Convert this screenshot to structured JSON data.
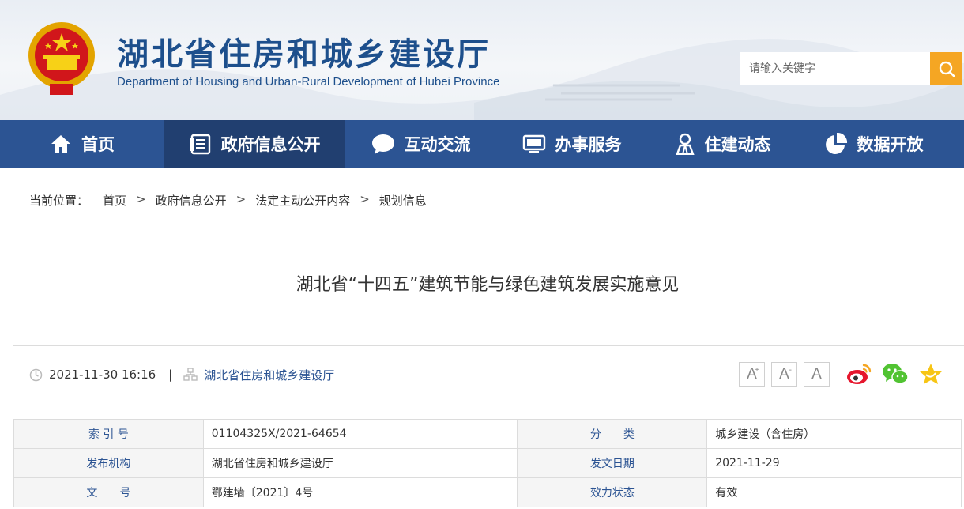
{
  "header": {
    "title": "湖北省住房和城乡建设厅",
    "subtitle": "Department of Housing and Urban-Rural Development of Hubei Province",
    "search_placeholder": "请输入关键字"
  },
  "nav": {
    "items": [
      {
        "label": "首页",
        "icon": "home-icon"
      },
      {
        "label": "政府信息公开",
        "icon": "document-list-icon"
      },
      {
        "label": "互动交流",
        "icon": "chat-bubble-icon"
      },
      {
        "label": "办事服务",
        "icon": "monitor-icon"
      },
      {
        "label": "住建动态",
        "icon": "person-icon"
      },
      {
        "label": "数据开放",
        "icon": "pie-chart-icon"
      }
    ],
    "active_index": 1
  },
  "breadcrumb": {
    "label": "当前位置：",
    "items": [
      "首页",
      "政府信息公开",
      "法定主动公开内容",
      "规划信息"
    ],
    "separator": ">"
  },
  "article": {
    "title": "湖北省“十四五”建筑节能与绿色建筑发展实施意见",
    "datetime": "2021-11-30 16:16",
    "separator": "|",
    "publisher": "湖北省住房和城乡建设厅"
  },
  "font_tools": {
    "increase": "A",
    "increase_sup": "+",
    "decrease": "A",
    "decrease_sup": "-",
    "reset": "A"
  },
  "share": [
    "weibo-icon",
    "wechat-icon",
    "favorite-star-icon"
  ],
  "info_table": {
    "rows": [
      {
        "k1": "索 引 号",
        "v1": "01104325X/2021-64654",
        "k2": "分　　类",
        "v2": "城乡建设（含住房）"
      },
      {
        "k1": "发布机构",
        "v1": "湖北省住房和城乡建设厅",
        "k2": "发文日期",
        "v2": "2021-11-29"
      },
      {
        "k1": "文　　号",
        "v1": "鄂建墙〔2021〕4号",
        "k2": "效力状态",
        "v2": "有效"
      }
    ]
  },
  "colors": {
    "nav_bg": "#2c5493",
    "nav_active": "#213f70",
    "title_blue": "#1d4f8c",
    "search_button": "#f5a623"
  }
}
